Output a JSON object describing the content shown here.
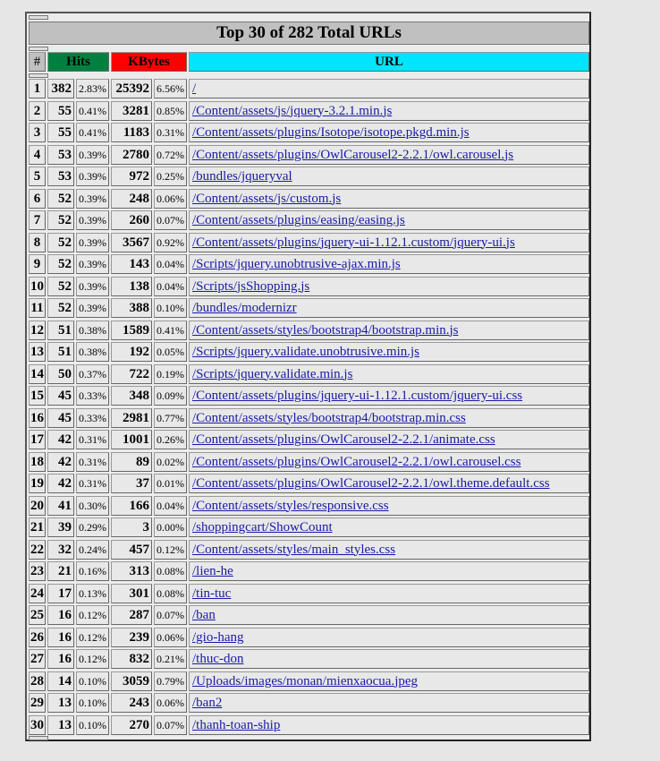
{
  "title": "Top 30 of 282 Total URLs",
  "headers": {
    "num": "#",
    "hits": "Hits",
    "kbytes": "KBytes",
    "url": "URL"
  },
  "colors": {
    "hits": "#008040",
    "kbytes": "#ff0000",
    "url": "#00e5ff"
  },
  "rows": [
    {
      "n": "1",
      "hits": "382",
      "hitsPct": "2.83%",
      "kb": "25392",
      "kbPct": "6.56%",
      "url": "/"
    },
    {
      "n": "2",
      "hits": "55",
      "hitsPct": "0.41%",
      "kb": "3281",
      "kbPct": "0.85%",
      "url": "/Content/assets/js/jquery-3.2.1.min.js"
    },
    {
      "n": "3",
      "hits": "55",
      "hitsPct": "0.41%",
      "kb": "1183",
      "kbPct": "0.31%",
      "url": "/Content/assets/plugins/Isotope/isotope.pkgd.min.js"
    },
    {
      "n": "4",
      "hits": "53",
      "hitsPct": "0.39%",
      "kb": "2780",
      "kbPct": "0.72%",
      "url": "/Content/assets/plugins/OwlCarousel2-2.2.1/owl.carousel.js"
    },
    {
      "n": "5",
      "hits": "53",
      "hitsPct": "0.39%",
      "kb": "972",
      "kbPct": "0.25%",
      "url": "/bundles/jqueryval"
    },
    {
      "n": "6",
      "hits": "52",
      "hitsPct": "0.39%",
      "kb": "248",
      "kbPct": "0.06%",
      "url": "/Content/assets/js/custom.js"
    },
    {
      "n": "7",
      "hits": "52",
      "hitsPct": "0.39%",
      "kb": "260",
      "kbPct": "0.07%",
      "url": "/Content/assets/plugins/easing/easing.js"
    },
    {
      "n": "8",
      "hits": "52",
      "hitsPct": "0.39%",
      "kb": "3567",
      "kbPct": "0.92%",
      "url": "/Content/assets/plugins/jquery-ui-1.12.1.custom/jquery-ui.js"
    },
    {
      "n": "9",
      "hits": "52",
      "hitsPct": "0.39%",
      "kb": "143",
      "kbPct": "0.04%",
      "url": "/Scripts/jquery.unobtrusive-ajax.min.js"
    },
    {
      "n": "10",
      "hits": "52",
      "hitsPct": "0.39%",
      "kb": "138",
      "kbPct": "0.04%",
      "url": "/Scripts/jsShopping.js"
    },
    {
      "n": "11",
      "hits": "52",
      "hitsPct": "0.39%",
      "kb": "388",
      "kbPct": "0.10%",
      "url": "/bundles/modernizr"
    },
    {
      "n": "12",
      "hits": "51",
      "hitsPct": "0.38%",
      "kb": "1589",
      "kbPct": "0.41%",
      "url": "/Content/assets/styles/bootstrap4/bootstrap.min.js"
    },
    {
      "n": "13",
      "hits": "51",
      "hitsPct": "0.38%",
      "kb": "192",
      "kbPct": "0.05%",
      "url": "/Scripts/jquery.validate.unobtrusive.min.js"
    },
    {
      "n": "14",
      "hits": "50",
      "hitsPct": "0.37%",
      "kb": "722",
      "kbPct": "0.19%",
      "url": "/Scripts/jquery.validate.min.js"
    },
    {
      "n": "15",
      "hits": "45",
      "hitsPct": "0.33%",
      "kb": "348",
      "kbPct": "0.09%",
      "url": "/Content/assets/plugins/jquery-ui-1.12.1.custom/jquery-ui.css"
    },
    {
      "n": "16",
      "hits": "45",
      "hitsPct": "0.33%",
      "kb": "2981",
      "kbPct": "0.77%",
      "url": "/Content/assets/styles/bootstrap4/bootstrap.min.css"
    },
    {
      "n": "17",
      "hits": "42",
      "hitsPct": "0.31%",
      "kb": "1001",
      "kbPct": "0.26%",
      "url": "/Content/assets/plugins/OwlCarousel2-2.2.1/animate.css"
    },
    {
      "n": "18",
      "hits": "42",
      "hitsPct": "0.31%",
      "kb": "89",
      "kbPct": "0.02%",
      "url": "/Content/assets/plugins/OwlCarousel2-2.2.1/owl.carousel.css"
    },
    {
      "n": "19",
      "hits": "42",
      "hitsPct": "0.31%",
      "kb": "37",
      "kbPct": "0.01%",
      "url": "/Content/assets/plugins/OwlCarousel2-2.2.1/owl.theme.default.css"
    },
    {
      "n": "20",
      "hits": "41",
      "hitsPct": "0.30%",
      "kb": "166",
      "kbPct": "0.04%",
      "url": "/Content/assets/styles/responsive.css"
    },
    {
      "n": "21",
      "hits": "39",
      "hitsPct": "0.29%",
      "kb": "3",
      "kbPct": "0.00%",
      "url": "/shoppingcart/ShowCount"
    },
    {
      "n": "22",
      "hits": "32",
      "hitsPct": "0.24%",
      "kb": "457",
      "kbPct": "0.12%",
      "url": "/Content/assets/styles/main_styles.css"
    },
    {
      "n": "23",
      "hits": "21",
      "hitsPct": "0.16%",
      "kb": "313",
      "kbPct": "0.08%",
      "url": "/lien-he"
    },
    {
      "n": "24",
      "hits": "17",
      "hitsPct": "0.13%",
      "kb": "301",
      "kbPct": "0.08%",
      "url": "/tin-tuc"
    },
    {
      "n": "25",
      "hits": "16",
      "hitsPct": "0.12%",
      "kb": "287",
      "kbPct": "0.07%",
      "url": "/ban"
    },
    {
      "n": "26",
      "hits": "16",
      "hitsPct": "0.12%",
      "kb": "239",
      "kbPct": "0.06%",
      "url": "/gio-hang"
    },
    {
      "n": "27",
      "hits": "16",
      "hitsPct": "0.12%",
      "kb": "832",
      "kbPct": "0.21%",
      "url": "/thuc-don"
    },
    {
      "n": "28",
      "hits": "14",
      "hitsPct": "0.10%",
      "kb": "3059",
      "kbPct": "0.79%",
      "url": "/Uploads/images/monan/mienxaocua.jpeg"
    },
    {
      "n": "29",
      "hits": "13",
      "hitsPct": "0.10%",
      "kb": "243",
      "kbPct": "0.06%",
      "url": "/ban2"
    },
    {
      "n": "30",
      "hits": "13",
      "hitsPct": "0.10%",
      "kb": "270",
      "kbPct": "0.07%",
      "url": "/thanh-toan-ship"
    }
  ]
}
